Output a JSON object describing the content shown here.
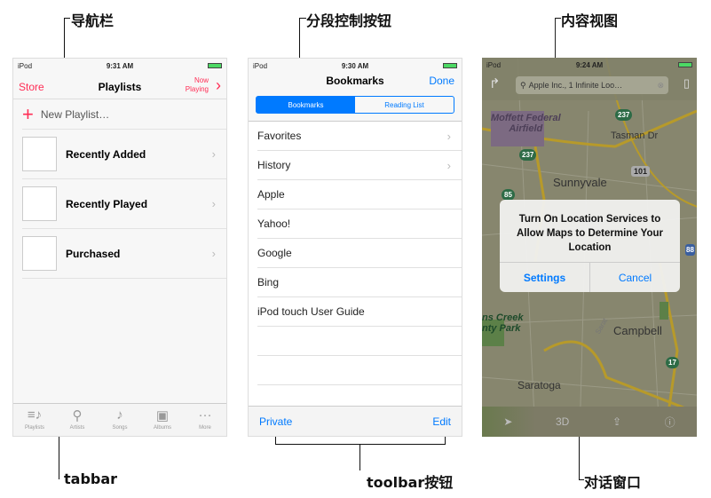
{
  "annotations": {
    "navbar": "导航栏",
    "segmented": "分段控制按钮",
    "content": "内容视图",
    "tabbar": "tabbar",
    "toolbar": "toolbar按钮",
    "dialog": "对话窗口"
  },
  "music": {
    "status": {
      "carrier": "iPod",
      "time": "9:31 AM"
    },
    "nav": {
      "left": "Store",
      "title": "Playlists",
      "right_line1": "Now",
      "right_line2": "Playing"
    },
    "new_playlist": "New Playlist…",
    "playlists": [
      {
        "label": "Recently Added"
      },
      {
        "label": "Recently Played"
      },
      {
        "label": "Purchased"
      }
    ],
    "tabs": [
      {
        "label": "Playlists",
        "icon": "playlists-icon"
      },
      {
        "label": "Artists",
        "icon": "artists-icon"
      },
      {
        "label": "Songs",
        "icon": "note-icon"
      },
      {
        "label": "Albums",
        "icon": "album-icon"
      },
      {
        "label": "More",
        "icon": "more-icon"
      }
    ],
    "accent": "#ff2d55"
  },
  "safari": {
    "status": {
      "carrier": "iPod",
      "time": "9:30 AM"
    },
    "nav": {
      "title": "Bookmarks",
      "right": "Done"
    },
    "segments": [
      "Bookmarks",
      "Reading List"
    ],
    "items": [
      {
        "label": "Favorites",
        "chevron": true
      },
      {
        "label": "History",
        "chevron": true
      },
      {
        "label": "Apple"
      },
      {
        "label": "Yahoo!"
      },
      {
        "label": "Google"
      },
      {
        "label": "Bing"
      },
      {
        "label": "iPod touch User Guide"
      }
    ],
    "toolbar": {
      "left": "Private",
      "right": "Edit"
    },
    "accent": "#007aff"
  },
  "maps": {
    "status": {
      "carrier": "iPod",
      "time": "9:24 AM"
    },
    "search_value": "Apple Inc., 1 Infinite Loo…",
    "labels": {
      "moffett": "Moffett Federal",
      "airfield": "Airfield",
      "tasman": "Tasman Dr",
      "sunnyvale": "Sunnyvale",
      "creek": "ns Creek",
      "park": "nty Park",
      "campbell": "Campbell",
      "saratoga": "Saratoga",
      "sarat": "Sarat"
    },
    "shields": {
      "a": "237",
      "b": "237",
      "c": "101",
      "d": "85",
      "e": "88",
      "f": "85",
      "g": "17"
    },
    "alert": {
      "message": "Turn On Location Services to Allow Maps to Determine Your Location",
      "settings": "Settings",
      "cancel": "Cancel"
    },
    "toolbar": {
      "threed": "3D"
    }
  }
}
